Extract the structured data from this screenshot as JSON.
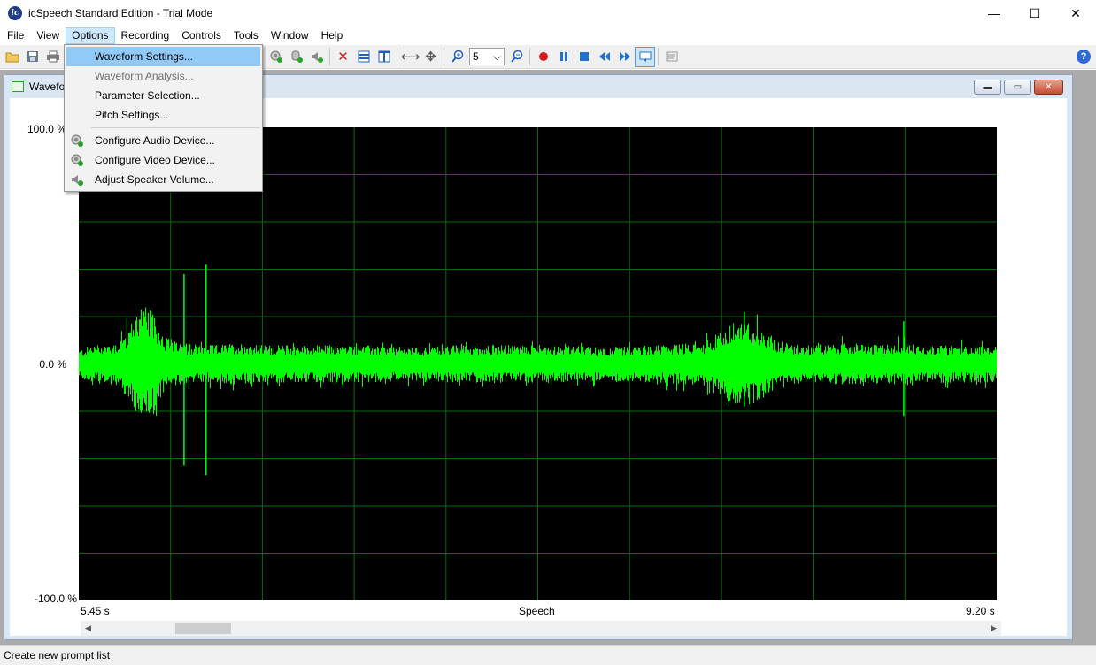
{
  "window": {
    "title": "icSpeech Standard Edition - Trial Mode",
    "app_icon_text": "ic",
    "minimize_glyph": "—",
    "maximize_glyph": "☐",
    "close_glyph": "✕"
  },
  "menubar": {
    "items": [
      "File",
      "View",
      "Options",
      "Recording",
      "Controls",
      "Tools",
      "Window",
      "Help"
    ],
    "active_item": "Options"
  },
  "toolbar": {
    "zoom_value": "5",
    "zoom_dropdown_glyph": "⌵",
    "help_glyph": "?"
  },
  "child_window": {
    "title": "Waveform",
    "visible_title": "Wavefo",
    "minimize_glyph": "▬",
    "restore_glyph": "▭",
    "close_glyph": "✕"
  },
  "options_menu": {
    "items": [
      {
        "label": "Waveform Settings...",
        "state": "hover",
        "icon": "none"
      },
      {
        "label": "Waveform Analysis...",
        "state": "disabled",
        "icon": "none"
      },
      {
        "label": "Parameter Selection...",
        "state": "normal",
        "icon": "none"
      },
      {
        "label": "Pitch Settings...",
        "state": "normal",
        "icon": "none"
      },
      {
        "label": "Configure Audio Device...",
        "state": "normal",
        "icon": "audio-device-icon"
      },
      {
        "label": "Configure Video Device...",
        "state": "normal",
        "icon": "video-device-icon"
      },
      {
        "label": "Adjust Speaker Volume...",
        "state": "normal",
        "icon": "speaker-volume-icon"
      }
    ]
  },
  "chart_data": {
    "type": "line",
    "title": "",
    "xlabel": "Speech",
    "ylabel": "",
    "x_start_label": "5.45 s",
    "x_end_label": "9.20 s",
    "xlim": [
      5.45,
      9.2
    ],
    "ylim": [
      -100,
      100
    ],
    "y_tick_labels": [
      "100.0 %",
      "0.0 %",
      "-100.0 %"
    ],
    "y_ticks": [
      100,
      0,
      -100
    ],
    "grid": true,
    "grid_divisions": {
      "x": 10,
      "y": 10
    },
    "background_color": "#000000",
    "grid_color": "#0a6b0a",
    "series": [
      {
        "color": "#00ff00",
        "envelope": {
          "t": [
            5.45,
            5.5,
            5.6,
            5.65,
            5.7,
            5.75,
            5.8,
            5.85,
            5.9,
            5.95,
            6.0,
            6.1,
            6.2,
            6.4,
            6.6,
            6.8,
            7.0,
            7.2,
            7.4,
            7.6,
            7.8,
            8.0,
            8.1,
            8.2,
            8.3,
            8.4,
            8.5,
            8.6,
            8.7,
            8.8,
            8.9,
            9.0,
            9.1,
            9.2
          ],
          "amp": [
            6,
            8,
            9,
            15,
            26,
            22,
            12,
            9,
            8,
            8,
            8,
            9,
            8,
            8,
            8,
            7,
            8,
            8,
            8,
            7,
            8,
            9,
            16,
            18,
            10,
            8,
            8,
            9,
            8,
            9,
            8,
            8,
            8,
            8
          ]
        },
        "spikes": [
          {
            "t": 5.88,
            "max": 38,
            "min": -43
          },
          {
            "t": 5.97,
            "max": 42,
            "min": -47
          },
          {
            "t": 8.17,
            "max": 22,
            "min": -18
          },
          {
            "t": 8.82,
            "max": 18,
            "min": -22
          }
        ]
      }
    ]
  },
  "scrollbar": {
    "left_arrow": "◀",
    "right_arrow": "▶"
  },
  "statusbar": {
    "text": "Create new prompt list"
  },
  "colors": {
    "waveform": "#00ff00",
    "menu_hover": "#91c9f7",
    "record_red": "#d81a1a",
    "control_blue": "#1e73d2"
  }
}
